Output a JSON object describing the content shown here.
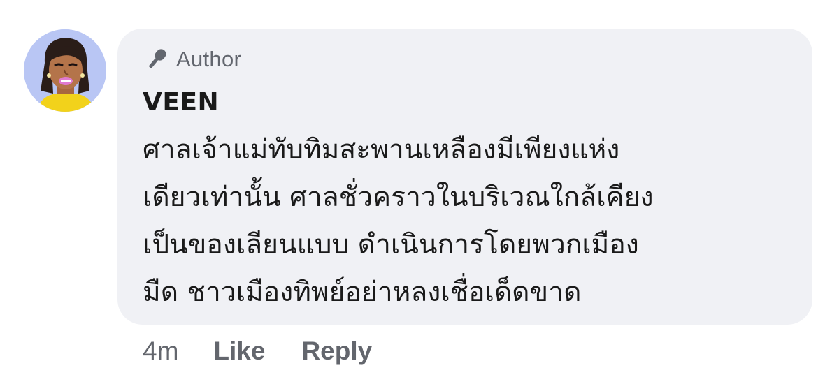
{
  "comment": {
    "badge": {
      "label": "Author",
      "icon": "microphone-icon"
    },
    "author_name": "VEEN",
    "text_lines": [
      "ศาลเจ้าแม่ทับทิมสะพานเหลืองมีเพียงแห่ง",
      "เดียวเท่านั้น ศาลชั่วคราวในบริเวณใกล้เคียง",
      "เป็นของเลียนแบบ ดำเนินการโดยพวกเมือง",
      "มืด ชาวเมืองทิพย์อย่าหลงเชื่อเด็ดขาด"
    ],
    "timestamp": "4m",
    "like_label": "Like",
    "reply_label": "Reply"
  },
  "colors": {
    "bubble_bg": "#f0f1f5",
    "muted_text": "#62666e",
    "main_text": "#1a1a1a",
    "avatar_bg": "#b9c6f4"
  }
}
